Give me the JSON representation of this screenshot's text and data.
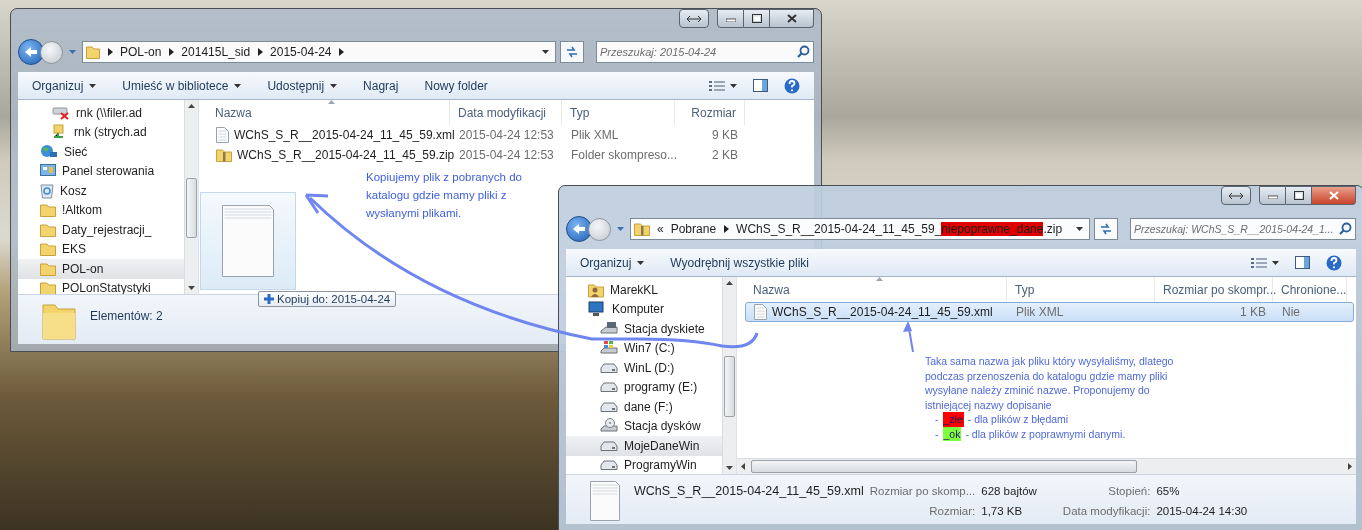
{
  "left_window": {
    "active": false,
    "breadcrumb": [
      "POL-on",
      "201415L_sid",
      "2015-04-24"
    ],
    "search": {
      "placeholder": "Przeszukaj: 2015-04-24"
    },
    "toolbar": [
      {
        "label": "Organizuj",
        "dropdown": true
      },
      {
        "label": "Umieść w bibliotece",
        "dropdown": true
      },
      {
        "label": "Udostępnij",
        "dropdown": true
      },
      {
        "label": "Nagraj",
        "dropdown": false
      },
      {
        "label": "Nowy folder",
        "dropdown": false
      }
    ],
    "sidebar": {
      "items": [
        {
          "label": "rnk (\\\\filer.ad",
          "kind": "netdrive_error",
          "selected": false
        },
        {
          "label": "rnk (strych.ad",
          "kind": "netdrive",
          "selected": false
        },
        {
          "label": "Sieć",
          "kind": "network",
          "selected": false
        },
        {
          "label": "Panel sterowania",
          "kind": "panel",
          "selected": false
        },
        {
          "label": "Kosz",
          "kind": "bin",
          "selected": false
        },
        {
          "label": "!Altkom",
          "kind": "folder",
          "selected": false
        },
        {
          "label": "Daty_rejestracji_",
          "kind": "folder",
          "selected": false
        },
        {
          "label": "EKS",
          "kind": "folder",
          "selected": false
        },
        {
          "label": "POL-on",
          "kind": "folder",
          "selected": true
        },
        {
          "label": "POLonStatystyki",
          "kind": "folder",
          "selected": false
        }
      ]
    },
    "columns": [
      {
        "label": "Nazwa",
        "kind": "name"
      },
      {
        "label": "Data modyfikacji",
        "kind": "date"
      },
      {
        "label": "Typ",
        "kind": "type"
      },
      {
        "label": "Rozmiar",
        "kind": "size"
      }
    ],
    "rows": [
      {
        "kind": "file",
        "selected": false,
        "cells": [
          "WChS_S_R__2015-04-24_11_45_59.xml",
          "2015-04-24 12:53",
          "Plik XML",
          "9 KB"
        ]
      },
      {
        "kind": "zip",
        "selected": false,
        "cells": [
          "WChS_S_R__2015-04-24_11_45_59.zip",
          "2015-04-24 12:53",
          "Folder skompreso...",
          "2 KB"
        ]
      }
    ],
    "drag_tooltip": "Kopiuj do: 2015-04-24",
    "status": "Elementów: 2"
  },
  "right_window": {
    "active": true,
    "breadcrumb_prefix": "«",
    "breadcrumb": [
      {
        "parts": [
          {
            "text": "Pobrane",
            "highlight": false
          }
        ]
      },
      {
        "parts": [
          {
            "text": "WChS_S_R__2015-04-24_11_45_59_",
            "highlight": false
          },
          {
            "text": "niepoprawne_dane",
            "highlight": true
          },
          {
            "text": ".zip",
            "highlight": false
          }
        ]
      }
    ],
    "search": {
      "placeholder": "Przeszukaj: WChS_S_R__2015-04-24_1..."
    },
    "toolbar": [
      {
        "label": "Organizuj",
        "dropdown": true
      },
      {
        "label": "Wyodrębnij wszystkie pliki",
        "dropdown": false
      }
    ],
    "sidebar": {
      "items": [
        {
          "label": "MarekKL",
          "kind": "user",
          "selected": false
        },
        {
          "label": "Komputer",
          "kind": "computer",
          "selected": false
        },
        {
          "label": "Stacja dyskiete",
          "kind": "floppy",
          "selected": false
        },
        {
          "label": "Win7 (C:)",
          "kind": "windrive",
          "selected": false
        },
        {
          "label": "WinL (D:)",
          "kind": "drive",
          "selected": false
        },
        {
          "label": "programy (E:)",
          "kind": "drive",
          "selected": false
        },
        {
          "label": "dane (F:)",
          "kind": "drive",
          "selected": false
        },
        {
          "label": "Stacja dysków",
          "kind": "cdrom",
          "selected": false
        },
        {
          "label": "MojeDaneWin",
          "kind": "drive",
          "selected": true
        },
        {
          "label": "ProgramyWin",
          "kind": "drive",
          "selected": false
        }
      ]
    },
    "columns": [
      {
        "label": "Nazwa",
        "kind": "name"
      },
      {
        "label": "Typ",
        "kind": "type"
      },
      {
        "label": "Rozmiar po skompr...",
        "kind": "size"
      },
      {
        "label": "Chronione...",
        "kind": "flag"
      }
    ],
    "rows": [
      {
        "kind": "file",
        "selected": true,
        "cells": [
          "WChS_S_R__2015-04-24_11_45_59.xml",
          "Plik XML",
          "1 KB",
          "Nie"
        ]
      }
    ],
    "details": {
      "name": "WChS_S_R__2015-04-24_11_45_59.xml",
      "fields": [
        {
          "label": "Rozmiar po skomp...",
          "value": "628 bajtów"
        },
        {
          "label": "Rozmiar:",
          "value": "1,73 KB"
        },
        {
          "label": "Stopień:",
          "value": "65%"
        },
        {
          "label": "Data modyfikacji:",
          "value": "2015-04-24 14:30"
        }
      ]
    }
  },
  "annotations": {
    "copy_note": "Kopiujemy plik z pobranych do katalogu gdzie mamy pliki z wysłanymi plikami.",
    "rename_note": "Taka sama nazwa jak pliku który wysyłaliśmy, dlatego podczas przenoszenia do katalogu gdzie mamy pliki wysyłane należy zminić nazwe. Proponujemy do istniejącej nazwy dopisanie",
    "suffixes": [
      {
        "dash": "-",
        "tag": "_złe",
        "color": "#ff0000",
        "text": "- dla plików z błędami"
      },
      {
        "dash": "-",
        "tag": "_ok",
        "color": "#80ff40",
        "text": "- dla plików z poprawnymi danymi."
      }
    ]
  }
}
